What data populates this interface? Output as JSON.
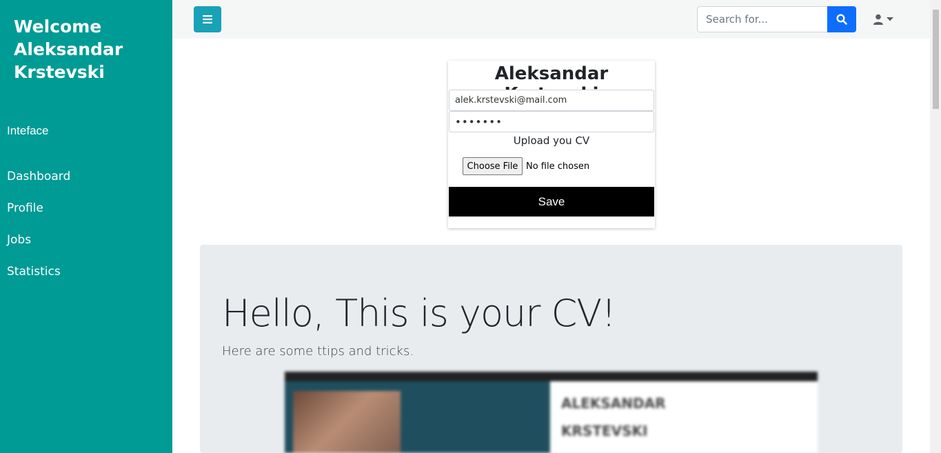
{
  "sidebar": {
    "welcome": "Welcome Aleksandar Krstevski",
    "section_title": "Inteface",
    "items": [
      {
        "label": "Dashboard"
      },
      {
        "label": "Profile"
      },
      {
        "label": "Jobs"
      },
      {
        "label": "Statistics"
      }
    ]
  },
  "topbar": {
    "menu_icon": "hamburger-icon",
    "search_placeholder": "Search for...",
    "search_icon": "search-icon",
    "user_icon": "user-icon",
    "caret_icon": "caret-down-icon"
  },
  "profile_card": {
    "name": "Aleksandar Krstevski",
    "email": "alek.krstevski@mail.com",
    "password_masked": "•••••••",
    "upload_label": "Upload you CV",
    "choose_file_label": "Choose File",
    "no_file_label": "No file chosen",
    "save_label": "Save"
  },
  "cv_section": {
    "headline": "Hello, This is your CV!",
    "lead": "Here are some ttips and tricks.",
    "preview": {
      "name_line1": "ALEKSANDAR",
      "name_line2": "KRSTEVSKI"
    }
  },
  "colors": {
    "sidebar_bg": "#009b95",
    "toggle_bg": "#17a2b8",
    "search_btn_bg": "#0d6efd",
    "save_bg": "#000000",
    "jumbotron_bg": "#e9ecef"
  }
}
